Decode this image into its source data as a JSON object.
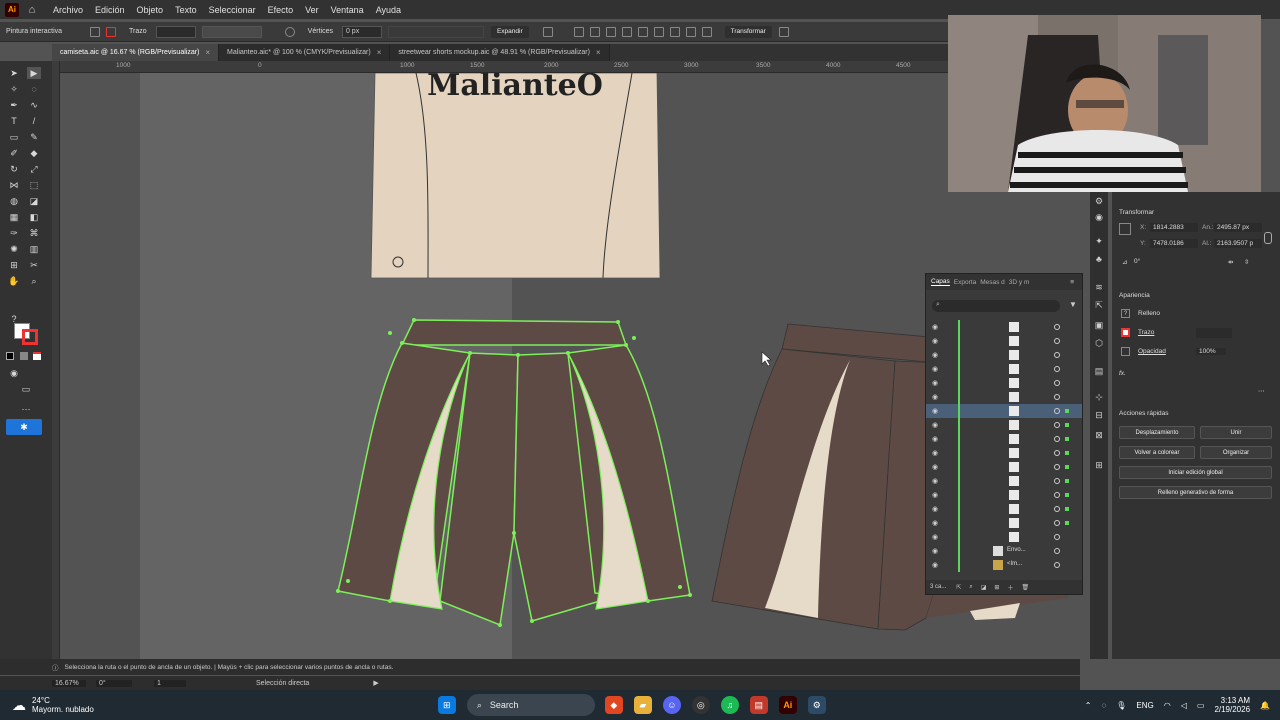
{
  "app": {
    "logo": "Ai",
    "menu": [
      "Archivo",
      "Edición",
      "Objeto",
      "Texto",
      "Seleccionar",
      "Efecto",
      "Ver",
      "Ventana",
      "Ayuda"
    ]
  },
  "control_bar": {
    "mode_label": "Pintura interactiva",
    "stroke_label": "Trazo",
    "vertices_label": "Vértices",
    "stroke_value": "0 px",
    "expand_button": "Expandir",
    "transform_button": "Transformar"
  },
  "tabs": [
    {
      "label": "camiseta.aic @ 16.67 % (RGB/Previsualizar)",
      "active": true
    },
    {
      "label": "Malianteo.aic* @ 100 % (CMYK/Previsualizar)",
      "active": false
    },
    {
      "label": "streetwear shorts mockup.aic @ 48.91 % (RGB/Previsualizar)",
      "active": false
    }
  ],
  "ruler_top": [
    "1000",
    "0",
    "1000",
    "1500",
    "2000",
    "2500",
    "3000",
    "3500",
    "4000",
    "4500"
  ],
  "artwork": {
    "tshirt_text": "MalianteO",
    "tshirt_color": "#e3d3bf",
    "shorts_brown": "#5e4a44",
    "shorts_cream": "#e6dac8",
    "selection_color": "#7cf05a"
  },
  "properties": {
    "transform_title": "Transformar",
    "x_label": "X:",
    "x_value": "1814.2883",
    "y_label": "Y:",
    "y_value": "7478.0186",
    "w_label": "An.:",
    "w_value": "2495.87 px",
    "h_label": "Al.:",
    "h_value": "2163.9507 p",
    "angle_value": "0°",
    "appearance_title": "Apariencia",
    "fill_label": "Relleno",
    "stroke_label": "Trazo",
    "opacity_label": "Opacidad",
    "opacity_value": "100%",
    "fx_label": "fx.",
    "quick_actions_title": "Acciones rápidas",
    "btn_offset": "Desplazamiento",
    "btn_unite": "Unir",
    "btn_recolor": "Volver a colorear",
    "btn_arrange": "Organizar",
    "btn_global_edit": "Iniciar edición global",
    "btn_gen_fill": "Relleno generativo de forma"
  },
  "layers_panel": {
    "tabs": [
      "Capas",
      "Exporta",
      "Mesas d",
      "3D y m"
    ],
    "rows": [
      {
        "name": ""
      },
      {
        "name": ""
      },
      {
        "name": ""
      },
      {
        "name": ""
      },
      {
        "name": ""
      },
      {
        "name": ""
      },
      {
        "name": "",
        "selected": true
      },
      {
        "name": ""
      },
      {
        "name": ""
      },
      {
        "name": ""
      },
      {
        "name": ""
      },
      {
        "name": ""
      },
      {
        "name": ""
      },
      {
        "name": ""
      },
      {
        "name": ""
      },
      {
        "name": ""
      },
      {
        "name": "Envo..."
      },
      {
        "name": "<Im..."
      }
    ],
    "footer_label": "3 ca..."
  },
  "status": {
    "message": "Selecciona la ruta o el punto de ancla de un objeto. | Mayús + clic para seleccionar varios puntos de ancla o rutas.",
    "zoom": "16.67%",
    "rotation": "0°",
    "artboard": "1",
    "tool": "Selección directa"
  },
  "taskbar": {
    "weather_temp": "24°C",
    "weather_desc": "Mayorm. nublado",
    "search_label": "Search",
    "lang": "ENG",
    "time": "3:13 AM",
    "date": "2/19/2026"
  }
}
